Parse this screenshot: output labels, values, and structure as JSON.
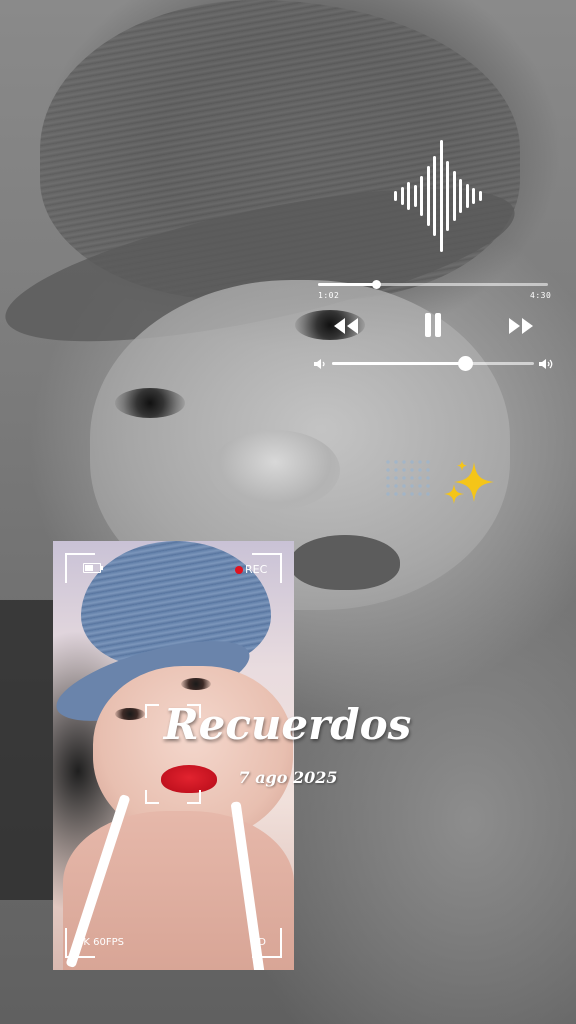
{
  "player": {
    "time_elapsed": "1:02",
    "time_total": "4:30",
    "progress_fraction": 0.25,
    "volume_fraction": 0.66,
    "icons": {
      "wave": "audio-wave-icon",
      "rewind": "rewind-icon",
      "pause": "pause-icon",
      "forward": "fast-forward-icon",
      "volume_low": "volume-low-icon",
      "volume_high": "volume-high-icon"
    }
  },
  "decoration": {
    "sparkles_icon": "sparkles-icon",
    "sparkles_color": "#f5c518"
  },
  "camera_overlay": {
    "rec_label": "REC",
    "resolution_label": "4K 60FPS",
    "quality_label": "HD",
    "rec_color": "#e0121f",
    "battery_icon": "battery-icon"
  },
  "title": "Recuerdos",
  "date": "7 ago 2025"
}
